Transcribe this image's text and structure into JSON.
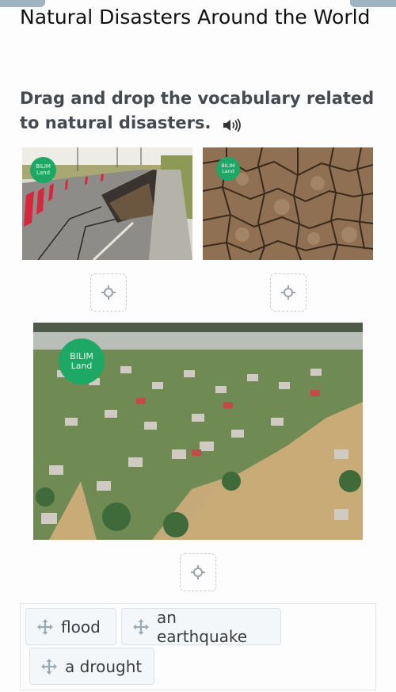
{
  "header": {
    "title": "Natural Disasters Around the World",
    "instruction": "Drag and drop the vocabulary related to natural disasters.",
    "audio_icon": "speaker-icon"
  },
  "images": [
    {
      "id": "earthquake",
      "description": "cracked road after an earthquake",
      "logo_line1": "BILIM",
      "logo_line2": "Land"
    },
    {
      "id": "drought",
      "description": "dry cracked earth",
      "logo_line1": "BILIM",
      "logo_line2": "Land"
    },
    {
      "id": "flood",
      "description": "aerial view of flooded town",
      "logo_line1": "BILIM",
      "logo_line2": "Land"
    }
  ],
  "drop_zones": [
    {
      "id": "drop-1",
      "icon": "target-icon",
      "value": ""
    },
    {
      "id": "drop-2",
      "icon": "target-icon",
      "value": ""
    },
    {
      "id": "drop-3",
      "icon": "target-icon",
      "value": ""
    }
  ],
  "word_bank": {
    "items": [
      {
        "label": "flood",
        "icon": "move-icon"
      },
      {
        "label": "an earthquake",
        "icon": "move-icon"
      },
      {
        "label": "a drought",
        "icon": "move-icon"
      }
    ]
  },
  "colors": {
    "logo_green": "#1ea865",
    "chip_bg": "#f4f7fa",
    "chip_border": "#dde2e7",
    "drop_border": "#c9cdd1",
    "instruction_text": "#444a50",
    "tab_bar": "#9fb3c0"
  }
}
